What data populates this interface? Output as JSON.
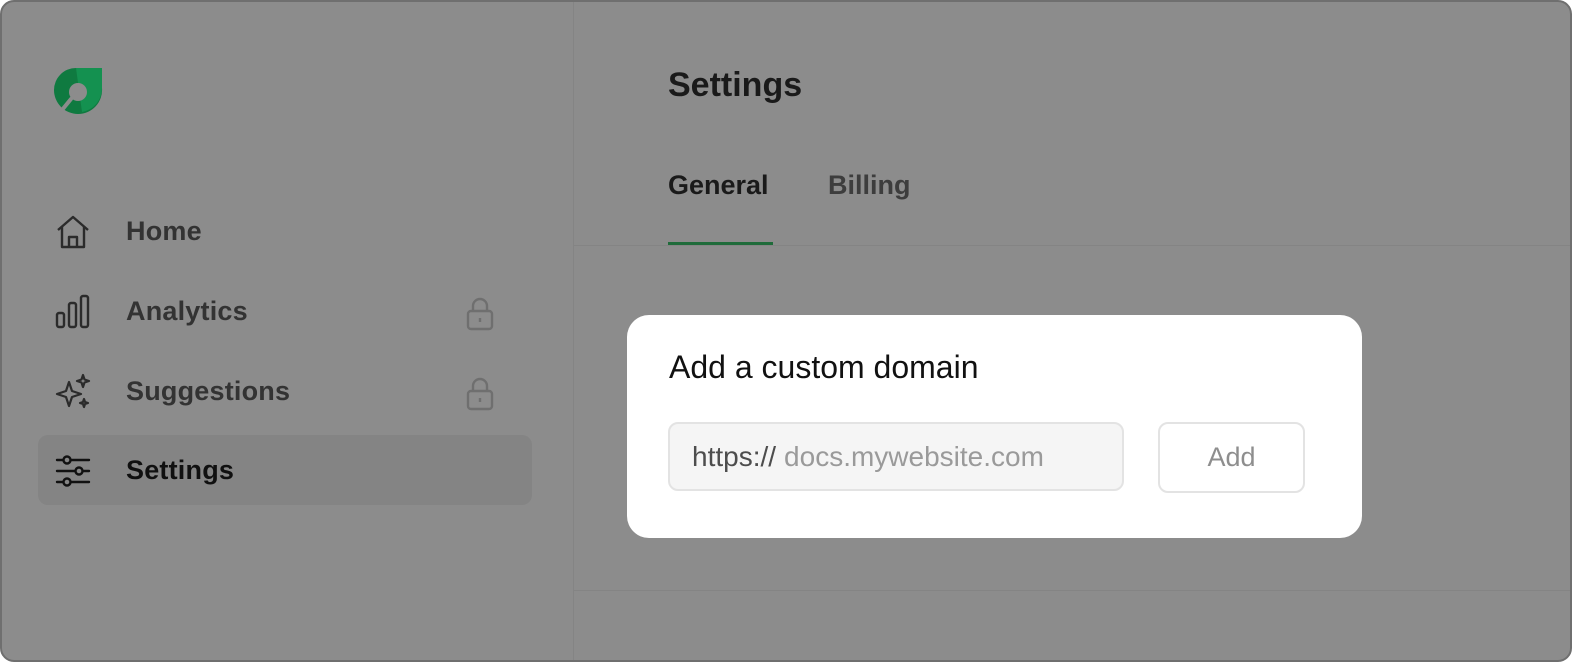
{
  "sidebar": {
    "logo_icon": "leaf-logo-icon",
    "brand_color": "#0f8a4a",
    "items": [
      {
        "label": "Home",
        "icon": "home-icon",
        "locked": false
      },
      {
        "label": "Analytics",
        "icon": "bar-chart-icon",
        "locked": true
      },
      {
        "label": "Suggestions",
        "icon": "sparkles-icon",
        "locked": true
      },
      {
        "label": "Settings",
        "icon": "sliders-icon",
        "locked": false,
        "active": true
      }
    ]
  },
  "main": {
    "title": "Settings",
    "tabs": [
      {
        "label": "General",
        "active": true
      },
      {
        "label": "Billing",
        "active": false
      }
    ],
    "accent_color": "#1f6b3a"
  },
  "modal": {
    "title": "Add a custom domain",
    "domain_prefix": "https://",
    "domain_placeholder": "docs.mywebsite.com",
    "domain_value": "",
    "add_label": "Add"
  }
}
